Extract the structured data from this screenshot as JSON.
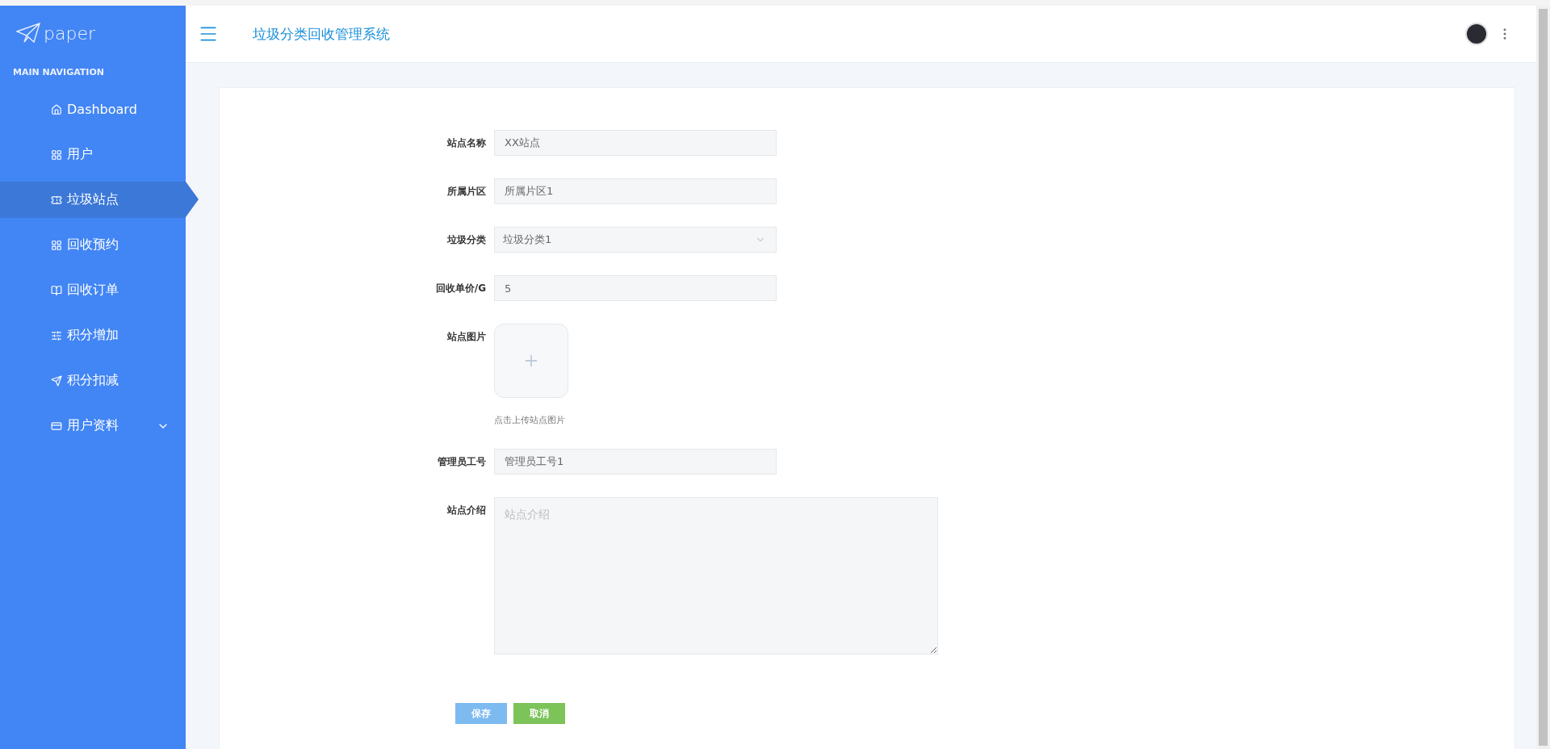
{
  "sidebar": {
    "logo": "paper",
    "section_title": "MAIN NAVIGATION",
    "items": [
      {
        "label": "Dashboard",
        "selected": false
      },
      {
        "label": "用户",
        "selected": false
      },
      {
        "label": "垃圾站点",
        "selected": true
      },
      {
        "label": "回收预约",
        "selected": false
      },
      {
        "label": "回收订单",
        "selected": false
      },
      {
        "label": "积分增加",
        "selected": false
      },
      {
        "label": "积分扣减",
        "selected": false
      },
      {
        "label": "用户资料",
        "selected": false,
        "expanded": false
      }
    ]
  },
  "header": {
    "title": "垃圾分类回收管理系统"
  },
  "form": {
    "fields": [
      {
        "kind": "text",
        "label": "站点名称",
        "value": "XX站点"
      },
      {
        "kind": "text",
        "label": "所属片区",
        "value": "所属片区1"
      },
      {
        "kind": "select",
        "label": "垃圾分类",
        "value": "垃圾分类1"
      },
      {
        "kind": "text",
        "label": "回收单价/G",
        "value": "5"
      },
      {
        "kind": "upload",
        "label": "站点图片",
        "hint": "点击上传站点图片"
      },
      {
        "kind": "text",
        "label": "管理员工号",
        "value": "管理员工号1"
      },
      {
        "kind": "textarea",
        "label": "站点介绍",
        "placeholder": "站点介绍"
      }
    ],
    "buttons": [
      {
        "label": "保存",
        "kind": "primary"
      },
      {
        "label": "取消",
        "kind": "success"
      }
    ]
  }
}
